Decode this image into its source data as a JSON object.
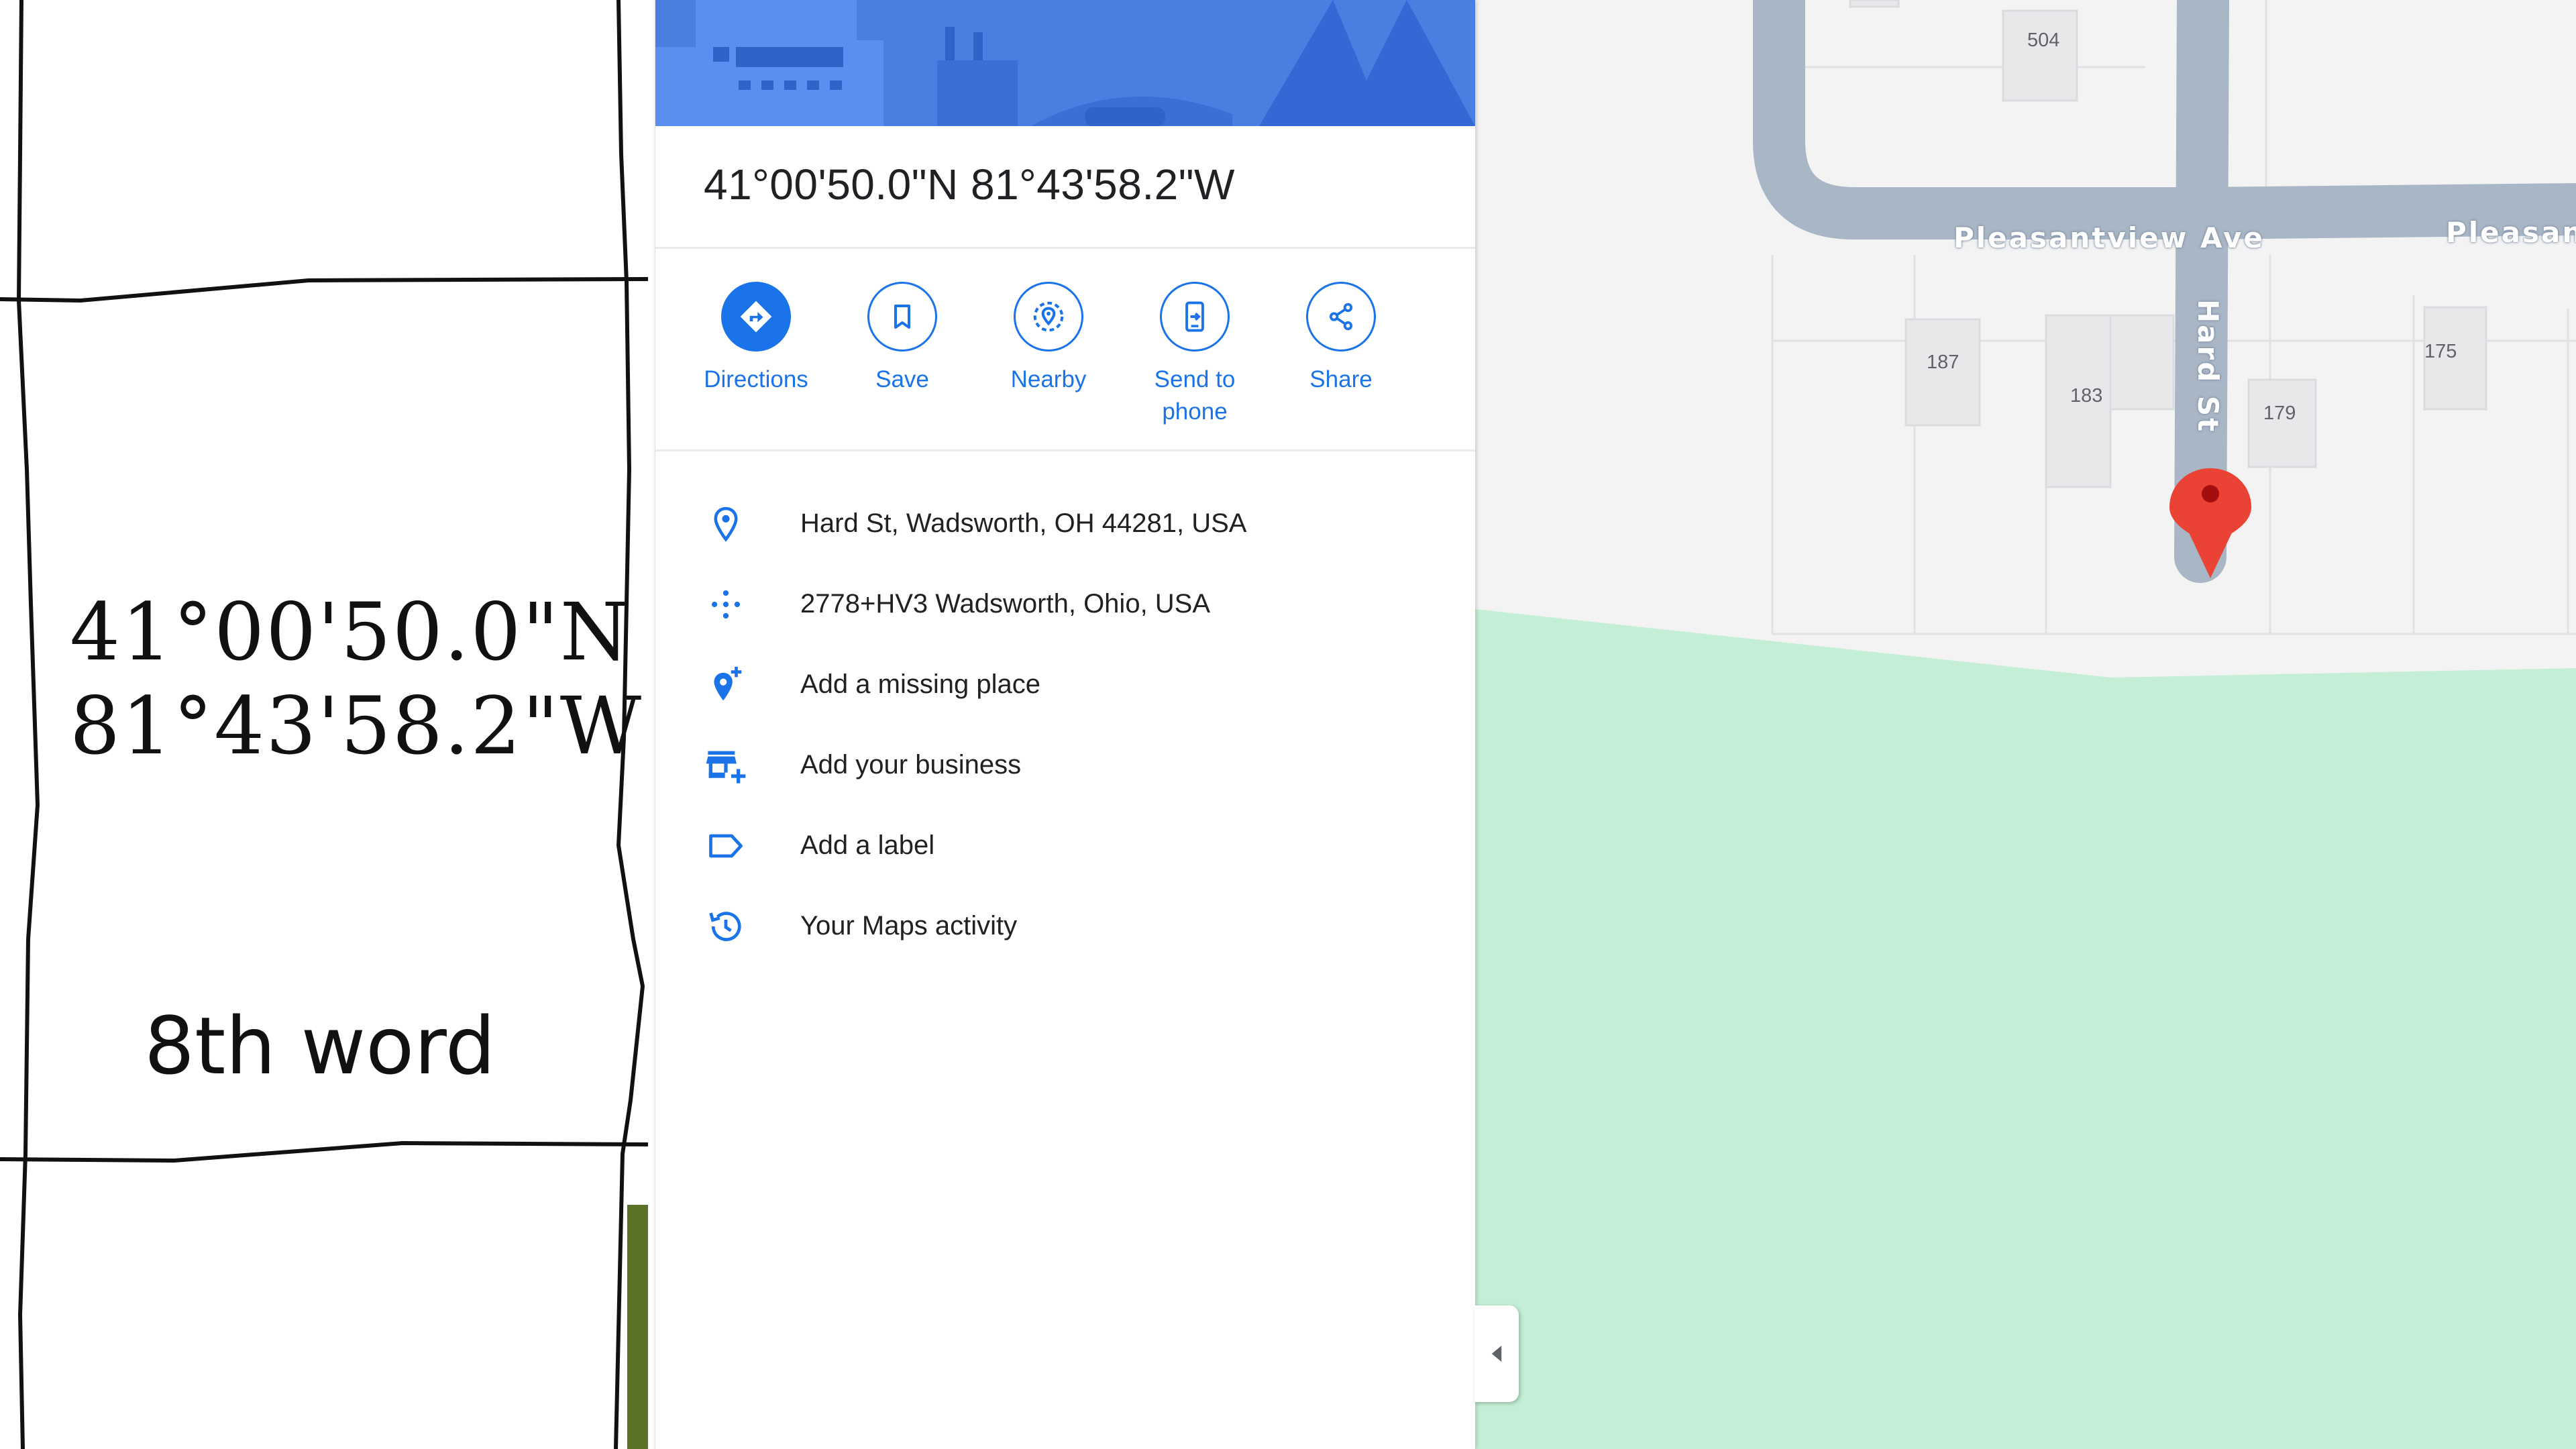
{
  "sketch": {
    "coord_line_1": "41°00'50.0\"N",
    "coord_line_2": "81°43'58.2\"W",
    "word": "8th word"
  },
  "place": {
    "title": "41°00'50.0\"N 81°43'58.2\"W"
  },
  "actions": [
    {
      "label": "Directions",
      "icon": "directions-icon"
    },
    {
      "label": "Save",
      "icon": "bookmark-icon"
    },
    {
      "label": "Nearby",
      "icon": "nearby-icon"
    },
    {
      "label": "Send to phone",
      "icon": "send-to-phone-icon"
    },
    {
      "label": "Share",
      "icon": "share-icon"
    }
  ],
  "info_rows": [
    {
      "text": "Hard St, Wadsworth, OH 44281, USA",
      "icon": "location-pin-icon"
    },
    {
      "text": "2778+HV3 Wadsworth, Ohio, USA",
      "icon": "plus-code-icon"
    },
    {
      "text": "Add a missing place",
      "icon": "add-place-icon"
    },
    {
      "text": "Add your business",
      "icon": "add-business-icon"
    },
    {
      "text": "Add a label",
      "icon": "label-icon"
    },
    {
      "text": "Your Maps activity",
      "icon": "history-icon"
    }
  ],
  "map": {
    "streets": {
      "pleasantview_1": "Pleasantview Ave",
      "pleasantview_2": "Pleasant",
      "hard_st": "Hard St"
    },
    "house_numbers": [
      "504",
      "187",
      "183",
      "179",
      "175"
    ],
    "colors": {
      "road": "#a9b6c6",
      "park": "#c4efd6",
      "land": "#f3f3f3",
      "building": "#e8e8ea",
      "marker": "#ea4335",
      "accent": "#1a73e8"
    }
  }
}
